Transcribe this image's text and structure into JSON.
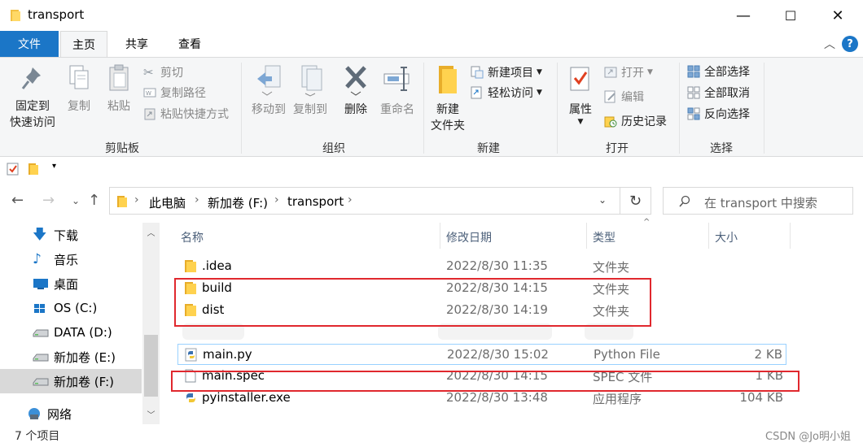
{
  "window": {
    "title": "transport",
    "minimize": "—",
    "maximize": "☐",
    "close": "✕"
  },
  "ribbon_tabs": [
    "文件",
    "主页",
    "共享",
    "查看"
  ],
  "ribbon": {
    "clipboard": {
      "pin": "固定到\n快速访问",
      "pin_l1": "固定到",
      "pin_l2": "快速访问",
      "copy": "复制",
      "paste": "粘贴",
      "cut": "剪切",
      "copy_path": "复制路径",
      "paste_shortcut": "粘贴快捷方式",
      "label": "剪贴板"
    },
    "organize": {
      "move_to": "移动到",
      "copy_to": "复制到",
      "delete": "删除",
      "rename": "重命名",
      "label": "组织"
    },
    "new": {
      "new_folder_l1": "新建",
      "new_folder_l2": "文件夹",
      "new_item": "新建项目",
      "easy_access": "轻松访问",
      "label": "新建"
    },
    "open": {
      "properties": "属性",
      "open": "打开",
      "edit": "编辑",
      "history": "历史记录",
      "label": "打开"
    },
    "select": {
      "select_all": "全部选择",
      "select_none": "全部取消",
      "invert": "反向选择",
      "label": "选择"
    }
  },
  "address": {
    "crumbs": [
      "此电脑",
      "新加卷 (F:)",
      "transport"
    ],
    "search_placeholder": "在 transport 中搜索"
  },
  "nav_pane": {
    "items": [
      "下载",
      "音乐",
      "桌面",
      "OS (C:)",
      "DATA (D:)",
      "新加卷 (E:)",
      "新加卷 (F:)",
      "网络"
    ],
    "selected": "新加卷 (F:)"
  },
  "columns": [
    "名称",
    "修改日期",
    "类型",
    "大小"
  ],
  "files": [
    {
      "name": ".idea",
      "date": "2022/8/30 11:35",
      "type": "文件夹",
      "size": "",
      "icon": "folder-icon"
    },
    {
      "name": "build",
      "date": "2022/8/30 14:15",
      "type": "文件夹",
      "size": "",
      "icon": "folder-icon"
    },
    {
      "name": "dist",
      "date": "2022/8/30 14:19",
      "type": "文件夹",
      "size": "",
      "icon": "folder-icon"
    },
    {
      "name": "main.py",
      "date": "2022/8/30 15:02",
      "type": "Python File",
      "size": "2 KB",
      "icon": "python-file-icon"
    },
    {
      "name": "main.spec",
      "date": "2022/8/30 14:15",
      "type": "SPEC 文件",
      "size": "1 KB",
      "icon": "blank-file-icon"
    },
    {
      "name": "pyinstaller.exe",
      "date": "2022/8/30 13:48",
      "type": "应用程序",
      "size": "104 KB",
      "icon": "python-exe-icon"
    }
  ],
  "status": {
    "count": "7 个项目",
    "watermark": "CSDN @Jo明小姐"
  },
  "colors": {
    "accent": "#1b76c7",
    "annotation": "#e0282e",
    "folder": "#f7c94d"
  }
}
